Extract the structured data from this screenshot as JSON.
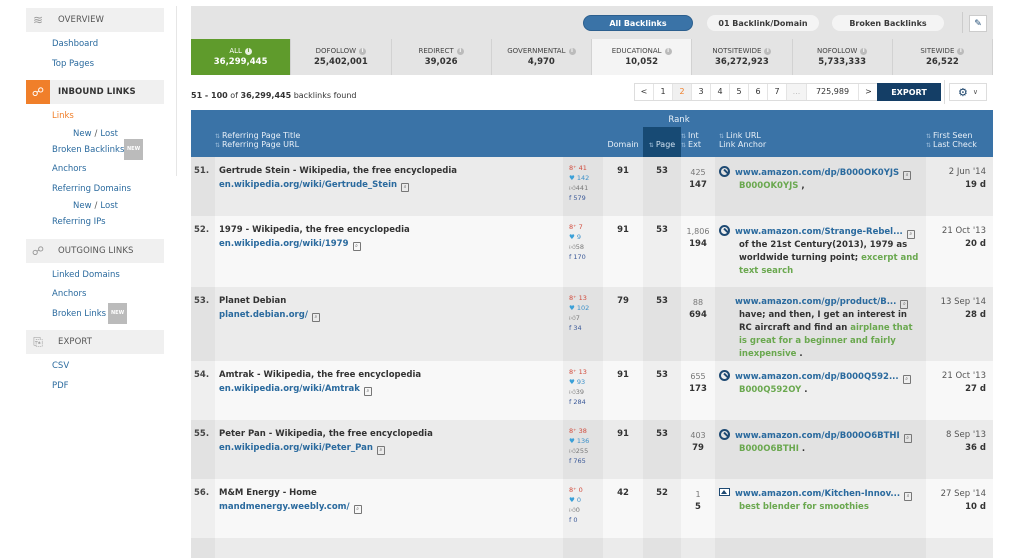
{
  "sidebar": {
    "sections": [
      {
        "id": "overview",
        "label": "OVERVIEW",
        "icon": "layers-icon"
      },
      {
        "id": "inbound",
        "label": "INBOUND LINKS",
        "icon": "link-hand-icon"
      },
      {
        "id": "outgoing",
        "label": "OUTGOING LINKS",
        "icon": "link-hand-icon"
      },
      {
        "id": "export",
        "label": "EXPORT",
        "icon": "export-doc-icon"
      }
    ],
    "overview_items": [
      "Dashboard",
      "Top Pages"
    ],
    "inbound": {
      "links": "Links",
      "new": "New",
      "lost": "Lost",
      "broken_backlinks": "Broken Backlinks",
      "new_badge": "NEW",
      "anchors": "Anchors",
      "referring_domains": "Referring Domains",
      "referring_ips": "Referring IPs"
    },
    "outgoing": {
      "linked_domains": "Linked Domains",
      "anchors": "Anchors",
      "broken_links": "Broken Links",
      "new_badge": "NEW"
    },
    "export_items": [
      "CSV",
      "PDF"
    ],
    "separator": "/"
  },
  "topbar": {
    "pills": [
      "All Backlinks",
      "01 Backlink/Domain",
      "Broken Backlinks"
    ],
    "active_pill": "All Backlinks",
    "edit_icon": "pencil-icon"
  },
  "filters": [
    {
      "label": "ALL",
      "value": "36,299,445",
      "state": "active"
    },
    {
      "label": "DOFOLLOW",
      "value": "25,402,001"
    },
    {
      "label": "REDIRECT",
      "value": "39,026"
    },
    {
      "label": "GOVERNMENTAL",
      "value": "4,970"
    },
    {
      "label": "EDUCATIONAL",
      "value": "10,052",
      "state": "selected"
    },
    {
      "label": "NOTSITEWIDE",
      "value": "36,272,923"
    },
    {
      "label": "NOFOLLOW",
      "value": "5,733,333"
    },
    {
      "label": "SITEWIDE",
      "value": "26,522"
    }
  ],
  "results": {
    "range": "51 - 100",
    "of": "of",
    "total": "36,299,445",
    "suffix": "backlinks found"
  },
  "pager": {
    "prev": "<",
    "pages": [
      "1",
      "2",
      "3",
      "4",
      "5",
      "6",
      "7"
    ],
    "current": "2",
    "dots": "...",
    "last": "725,989",
    "next": ">"
  },
  "export_label": "EXPORT",
  "table": {
    "headers": {
      "ref_title": "Referring Page Title",
      "ref_url": "Referring Page URL",
      "rank": "Rank",
      "domain": "Domain",
      "page": "Page",
      "int": "Int",
      "ext": "Ext",
      "link_url": "Link URL",
      "link_anchor": "Link Anchor",
      "first_seen": "First Seen",
      "last_check": "Last Check",
      "sort_glyph": "⇅"
    },
    "rows": [
      {
        "n": "51.",
        "title": "Gertrude Stein - Wikipedia, the free encyclopedia",
        "url": "en.wikipedia.org/wiki/Gertrude_Stein",
        "gplus": "41",
        "twitter": "142",
        "likes": "441",
        "facebook": "579",
        "rank_domain": "91",
        "rank_page": "53",
        "int": "425",
        "ext": "147",
        "link_icon": "nofollow-icon",
        "link_url": "www.amazon.com/dp/B000OK0YJS",
        "anchor": [
          {
            "t": "B000OK0YJS",
            "s": "green"
          },
          {
            "t": " ,",
            "s": "text"
          }
        ],
        "first_seen": "2 Jun '14",
        "last_check": "19 d"
      },
      {
        "n": "52.",
        "title": "1979 - Wikipedia, the free encyclopedia",
        "url": "en.wikipedia.org/wiki/1979",
        "gplus": "7",
        "twitter": "9",
        "likes": "58",
        "facebook": "170",
        "rank_domain": "91",
        "rank_page": "53",
        "int": "1,806",
        "ext": "194",
        "link_icon": "nofollow-icon",
        "link_url": "www.amazon.com/Strange-Rebel...",
        "anchor": [
          {
            "t": "of the 21st Century(2013), 1979 as worldwide turning point; ",
            "s": "text"
          },
          {
            "t": "excerpt and text search",
            "s": "green"
          }
        ],
        "first_seen": "21 Oct '13",
        "last_check": "20 d"
      },
      {
        "n": "53.",
        "title": "Planet Debian",
        "url": "planet.debian.org/",
        "gplus": "13",
        "twitter": "102",
        "likes": "7",
        "facebook": "34",
        "rank_domain": "79",
        "rank_page": "53",
        "int": "88",
        "ext": "694",
        "link_icon": "",
        "link_url": "www.amazon.com/gp/product/B...",
        "anchor": [
          {
            "t": "have; and then, I get an interest in RC aircraft and find an ",
            "s": "text"
          },
          {
            "t": "airplane that is great for a beginner and fairly inexpensive",
            "s": "green"
          },
          {
            "t": " .",
            "s": "text"
          }
        ],
        "first_seen": "13 Sep '14",
        "last_check": "28 d"
      },
      {
        "n": "54.",
        "title": "Amtrak - Wikipedia, the free encyclopedia",
        "url": "en.wikipedia.org/wiki/Amtrak",
        "gplus": "13",
        "twitter": "93",
        "likes": "39",
        "facebook": "284",
        "rank_domain": "91",
        "rank_page": "53",
        "int": "655",
        "ext": "173",
        "link_icon": "nofollow-icon",
        "link_url": "www.amazon.com/dp/B000Q592...",
        "anchor": [
          {
            "t": "B000Q592OY",
            "s": "green"
          },
          {
            "t": " .",
            "s": "text"
          }
        ],
        "first_seen": "21 Oct '13",
        "last_check": "27 d"
      },
      {
        "n": "55.",
        "title": "Peter Pan - Wikipedia, the free encyclopedia",
        "url": "en.wikipedia.org/wiki/Peter_Pan",
        "gplus": "38",
        "twitter": "136",
        "likes": "255",
        "facebook": "765",
        "rank_domain": "91",
        "rank_page": "53",
        "int": "403",
        "ext": "79",
        "link_icon": "nofollow-icon",
        "link_url": "www.amazon.com/dp/B000O6BTHI",
        "anchor": [
          {
            "t": "B000O6BTHI",
            "s": "green"
          },
          {
            "t": " .",
            "s": "text"
          }
        ],
        "first_seen": "8 Sep '13",
        "last_check": "36 d"
      },
      {
        "n": "56.",
        "title": "M&M Energy - Home",
        "url": "mandmenergy.weebly.com/",
        "gplus": "0",
        "twitter": "0",
        "likes": "0",
        "facebook": "0",
        "rank_domain": "42",
        "rank_page": "52",
        "int": "1",
        "ext": "5",
        "link_icon": "image-icon",
        "link_url": "www.amazon.com/Kitchen-Innov...",
        "anchor": [
          {
            "t": "best blender for smoothies",
            "s": "green"
          }
        ],
        "first_seen": "27 Sep '14",
        "last_check": "10 d"
      }
    ]
  },
  "colors": {
    "accent_orange": "#f07f2a",
    "header_blue": "#3a73a7",
    "sorted_blue": "#174a74",
    "active_green": "#5f9b2c",
    "link_blue": "#2a6a9e",
    "anchor_green": "#6aa84f"
  }
}
